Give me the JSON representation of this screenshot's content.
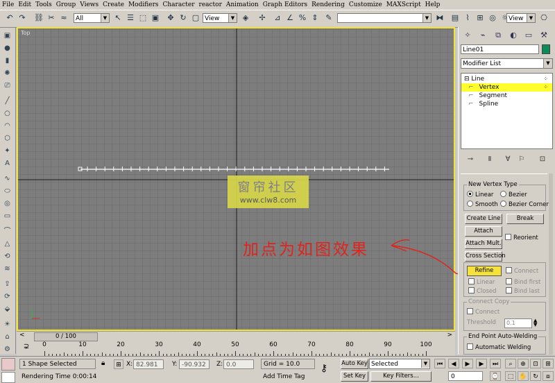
{
  "menu": [
    "File",
    "Edit",
    "Tools",
    "Group",
    "Views",
    "Create",
    "Modifiers",
    "Character",
    "reactor",
    "Animation",
    "Graph Editors",
    "Rendering",
    "Customize",
    "MAXScript",
    "Help"
  ],
  "toolbar": {
    "selection_filter": "All",
    "ref_coord": "View",
    "named_selection": "",
    "view_dropdown": "View"
  },
  "viewport": {
    "label": "Top",
    "accent_color": "#f5e332"
  },
  "watermark": {
    "line1": "窗帘社区",
    "line2": "www.clw8.com"
  },
  "annotation": {
    "text": "加点为如图效果",
    "color": "#e0231c"
  },
  "command_panel": {
    "object_name": "Line01",
    "object_color": "#0e8a5a",
    "modifier_list": "Modifier List",
    "stack": [
      {
        "label": "Line",
        "selected": false
      },
      {
        "label": "Vertex",
        "selected": true
      },
      {
        "label": "Segment",
        "selected": false
      },
      {
        "label": "Spline",
        "selected": false
      }
    ],
    "new_vertex_type": {
      "title": "New Vertex Type",
      "linear": "Linear",
      "bezier": "Bezier",
      "smooth": "Smooth",
      "bezier_corner": "Bezier Corner"
    },
    "buttons": {
      "create_line": "Create Line",
      "break": "Break",
      "attach": "Attach",
      "attach_mult": "Attach Mult.",
      "reorient": "Reorient",
      "cross_section": "Cross Section",
      "refine": "Refine",
      "connect": "Connect",
      "linear": "Linear",
      "bind_first": "Bind first",
      "closed": "Closed",
      "bind_last": "Bind last"
    },
    "connect_copy": {
      "title": "Connect Copy",
      "connect": "Connect",
      "threshold_label": "Threshold",
      "threshold_value": "0.1"
    },
    "end_point": {
      "title": "End Point Auto-Welding",
      "automatic": "Automatic Welding"
    }
  },
  "time_slider": "0 / 100",
  "trackbar_labels": [
    "0",
    "10",
    "20",
    "30",
    "40",
    "50",
    "60",
    "70",
    "80",
    "90",
    "100"
  ],
  "status": {
    "selection": "1 Shape Selected",
    "x_label": "X:",
    "x_value": "82.981",
    "y_label": "Y:",
    "y_value": "-90.932",
    "z_label": "Z:",
    "z_value": "0.0",
    "grid": "Grid = 10.0",
    "auto_key": "Auto Key",
    "key_mode": "Selected",
    "set_key": "Set Key",
    "key_filters": "Key Filters...",
    "frame": "0",
    "rendering_time": "Rendering Time  0:00:14",
    "add_time_tag": "Add Time Tag"
  }
}
